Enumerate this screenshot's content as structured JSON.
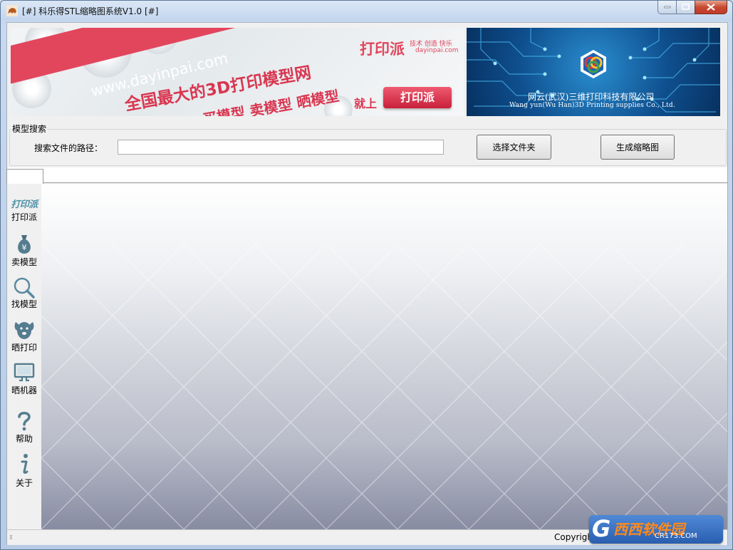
{
  "window": {
    "title": "[#] 科乐得STL缩略图系统V1.0 [#]",
    "controls": {
      "minimize": "minimize",
      "maximize": "maximize",
      "close": "close"
    }
  },
  "banner_left": {
    "url": "www.dayinpai.com",
    "slogan_line1": "全国最大的3D打印模型网",
    "slogan_line2": "买模型  卖模型  晒模型",
    "brand": "打印派",
    "brand_tagline": "技术 创造 快乐",
    "brand_site": "dayinpai.com",
    "cta_prefix": "就上",
    "cta_button": "打印派"
  },
  "banner_right": {
    "company_cn": "网云(武汉)三维打印科技有限公司",
    "company_en": "Wang yun(Wu Han)3D Printing supplies Co., Ltd."
  },
  "search": {
    "group_label": "模型搜索",
    "path_label": "搜索文件的路径：",
    "path_value": "",
    "choose_folder_button": "选择文件夹",
    "generate_button": "生成缩略图"
  },
  "sidebar": {
    "logo_text": "打印派",
    "items": [
      {
        "label": "打印派",
        "icon": "dayinpai-logo-icon"
      },
      {
        "label": "卖模型",
        "icon": "money-bag-icon"
      },
      {
        "label": "找模型",
        "icon": "magnifier-icon"
      },
      {
        "label": "晒打印",
        "icon": "dog-face-icon"
      },
      {
        "label": "晒机器",
        "icon": "monitor-icon"
      },
      {
        "label": "帮助",
        "icon": "question-icon"
      },
      {
        "label": "关于",
        "icon": "info-icon"
      }
    ]
  },
  "status": {
    "copyright": "Copyright"
  },
  "watermark": {
    "brand": "西西软件园",
    "domain": "CR173.COM"
  },
  "colors": {
    "brand_red": "#e2465d",
    "accent_blue": "#4d90a6",
    "title_bar": "#c2d5ee"
  }
}
